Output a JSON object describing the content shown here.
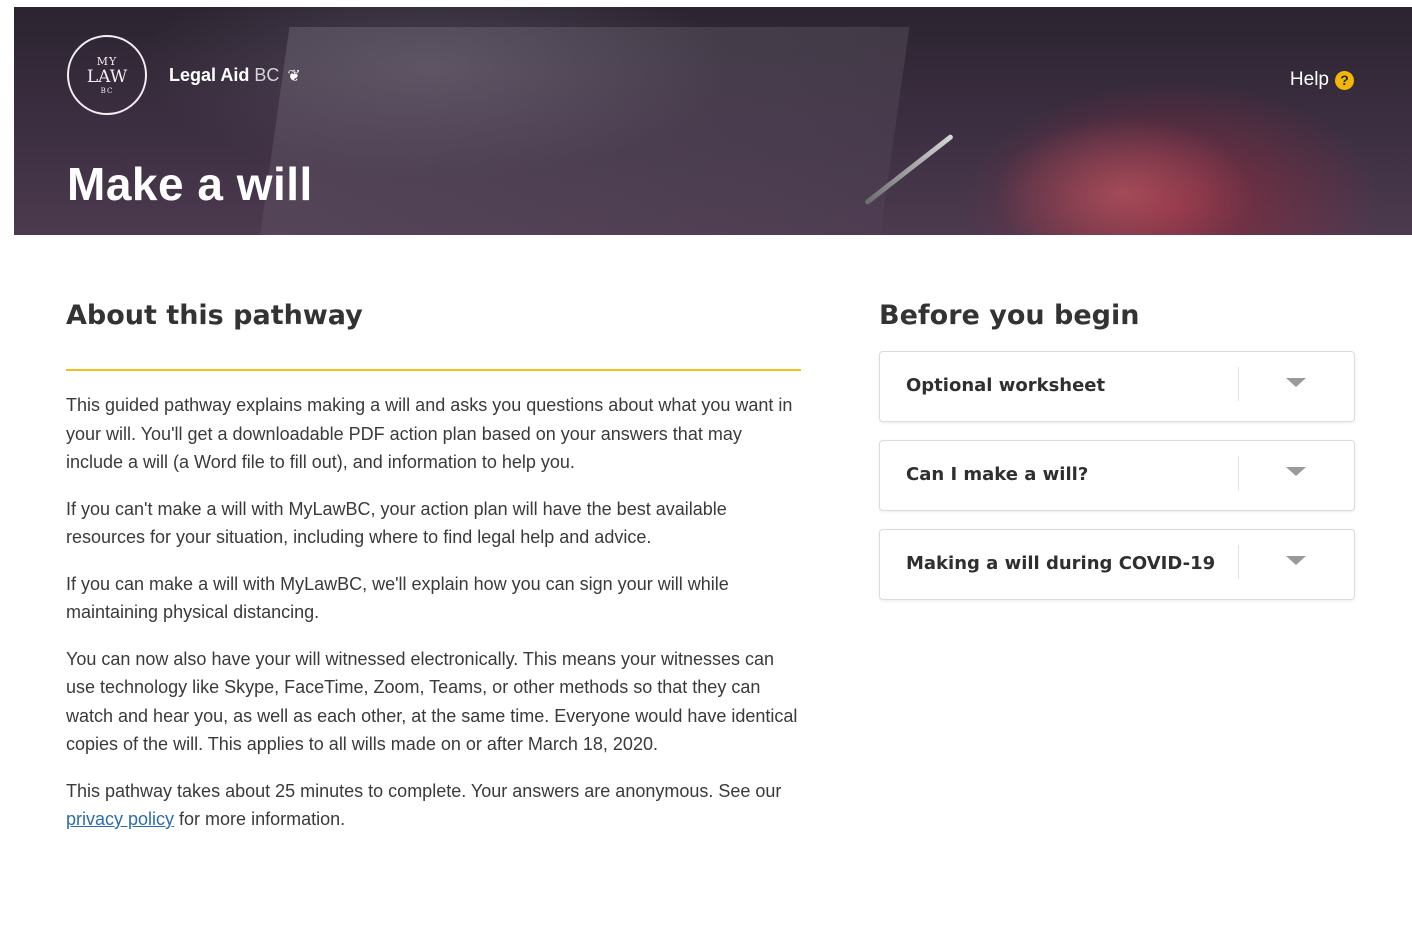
{
  "header": {
    "logo": {
      "line1": "MY",
      "line2": "LAW",
      "line3": "BC"
    },
    "brand": {
      "bold": "Legal Aid",
      "light": "BC"
    },
    "help_label": "Help",
    "help_icon": "?",
    "title": "Make a will",
    "accent_color": "#f2b705"
  },
  "about": {
    "heading": "About this pathway",
    "paragraphs": [
      "This guided pathway explains making a will and asks you questions about what you want in your will. You'll get a downloadable PDF action plan based on your answers that may include a will (a Word file to fill out), and information to help you.",
      "If you can't make a will with MyLawBC, your action plan will have the best available resources for your situation, including where to find legal help and advice.",
      "If you can make a will with MyLawBC, we'll explain how you can sign your will while maintaining physical distancing.",
      "You can now also have your will witnessed electronically. This means your witnesses can use technology like Skype, FaceTime, Zoom, Teams, or other methods so that they can watch and hear you, as well as each other, at the same time. Everyone would have identical copies of the will. This applies to all wills made on or after March 18, 2020."
    ],
    "last_paragraph": {
      "before": "This pathway takes about 25 minutes to complete. Your answers are anonymous. See our ",
      "link": "privacy policy",
      "after": " for more information."
    },
    "divider_color": "#f2c01e"
  },
  "before": {
    "heading": "Before you begin",
    "items": [
      {
        "label": "Optional worksheet",
        "icon": "chevron-down-icon"
      },
      {
        "label": "Can I make a will?",
        "icon": "chevron-down-icon"
      },
      {
        "label": "Making a will during COVID-19",
        "icon": "chevron-down-icon"
      }
    ]
  }
}
